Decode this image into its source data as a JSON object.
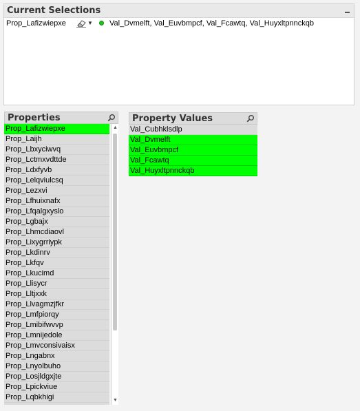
{
  "current_selections": {
    "title": "Current Selections",
    "field": "Prop_Lafizwiepxe",
    "values_text": "Val_Dvmelft, Val_Euvbmpcf, Val_Fcawtq, Val_Huyxltpnnckqb",
    "eraser_icon": "eraser-icon",
    "dropdown_glyph": "▼",
    "selection_dot_color": "#1fc41f"
  },
  "properties": {
    "title": "Properties",
    "search_icon": "search-icon",
    "selected_color": "#00ff00",
    "items": [
      {
        "label": "Prop_Lafizwiepxe",
        "selected": true
      },
      {
        "label": "Prop_Laijh",
        "selected": false
      },
      {
        "label": "Prop_Lbxyciwvq",
        "selected": false
      },
      {
        "label": "Prop_Lctmxvdttde",
        "selected": false
      },
      {
        "label": "Prop_Ldxfyvb",
        "selected": false
      },
      {
        "label": "Prop_Lelqviulcsq",
        "selected": false
      },
      {
        "label": "Prop_Lezxvi",
        "selected": false
      },
      {
        "label": "Prop_Lfhuixnafx",
        "selected": false
      },
      {
        "label": "Prop_Lfqalgxyslo",
        "selected": false
      },
      {
        "label": "Prop_Lgbajx",
        "selected": false
      },
      {
        "label": "Prop_Lhmcdiaovl",
        "selected": false
      },
      {
        "label": "Prop_Lixygrriypk",
        "selected": false
      },
      {
        "label": "Prop_Lkdinrv",
        "selected": false
      },
      {
        "label": "Prop_Lkfqv",
        "selected": false
      },
      {
        "label": "Prop_Lkucimd",
        "selected": false
      },
      {
        "label": "Prop_Llisycr",
        "selected": false
      },
      {
        "label": "Prop_Lltjxxk",
        "selected": false
      },
      {
        "label": "Prop_Llvagmzjfkr",
        "selected": false
      },
      {
        "label": "Prop_Lmfpiorqy",
        "selected": false
      },
      {
        "label": "Prop_Lmibifwvvp",
        "selected": false
      },
      {
        "label": "Prop_Lmnijedole",
        "selected": false
      },
      {
        "label": "Prop_Lmvconsivaisx",
        "selected": false
      },
      {
        "label": "Prop_Lngabnx",
        "selected": false
      },
      {
        "label": "Prop_Lnyolbuho",
        "selected": false
      },
      {
        "label": "Prop_Losjldgxjte",
        "selected": false
      },
      {
        "label": "Prop_Lpickviue",
        "selected": false
      },
      {
        "label": "Prop_Lqbkhigi",
        "selected": false
      }
    ]
  },
  "property_values": {
    "title": "Property Values",
    "search_icon": "search-icon",
    "items": [
      {
        "label": "Val_Cubhklsdlp",
        "selected": false
      },
      {
        "label": "Val_Dvmelft",
        "selected": true
      },
      {
        "label": "Val_Euvbmpcf",
        "selected": true
      },
      {
        "label": "Val_Fcawtq",
        "selected": true
      },
      {
        "label": "Val_Huyxltpnnckqb",
        "selected": true
      }
    ]
  }
}
